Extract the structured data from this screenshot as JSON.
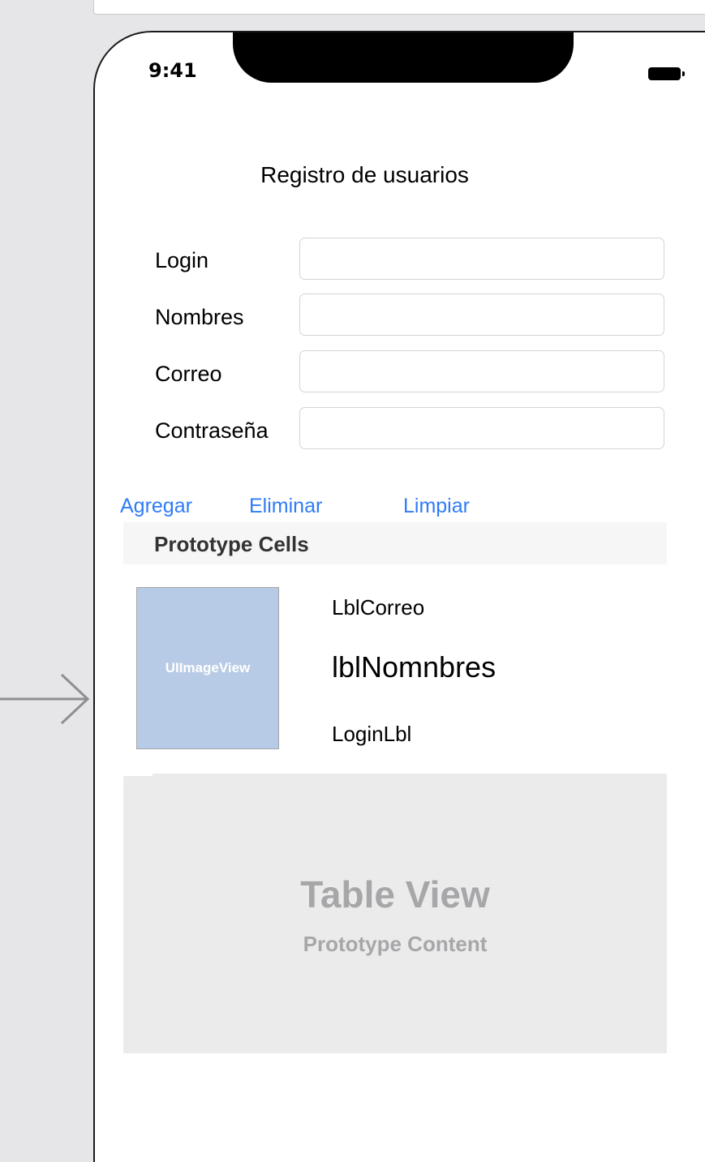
{
  "status_bar": {
    "time": "9:41"
  },
  "screen_title": "Registro de usuarios",
  "form": {
    "fields": [
      {
        "label": "Login",
        "value": "",
        "placeholder": ""
      },
      {
        "label": "Nombres",
        "value": "",
        "placeholder": ""
      },
      {
        "label": "Correo",
        "value": "",
        "placeholder": ""
      },
      {
        "label": "Contraseña",
        "value": "",
        "placeholder": ""
      }
    ]
  },
  "actions": {
    "add_label": "Agregar",
    "delete_label": "Eliminar",
    "clear_label": "Limpiar"
  },
  "table": {
    "section_header": "Prototype Cells",
    "cell": {
      "image_placeholder": "UIImageView",
      "correo_label": "LblCorreo",
      "nombres_label": "lblNomnbres",
      "login_label": "LoginLbl"
    },
    "placeholder_title": "Table View",
    "placeholder_subtitle": "Prototype Content"
  },
  "icons": {
    "entry_point": "arrow-right-icon",
    "battery": "battery-icon"
  },
  "colors": {
    "link": "#2f7cf6",
    "canvas_background": "#e6e6e8",
    "image_view_fill": "#b8cbe6",
    "placeholder_text": "#a7a7a9"
  }
}
